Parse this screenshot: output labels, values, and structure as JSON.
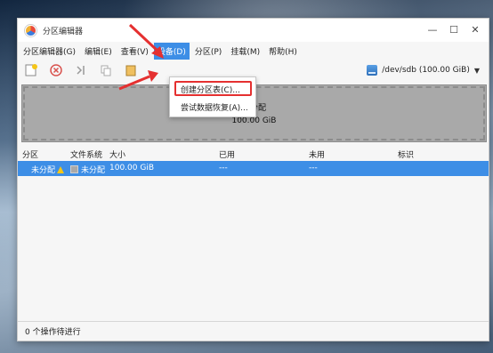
{
  "window": {
    "title": "分区编辑器",
    "controls": [
      "minimize-icon",
      "maximize-icon",
      "close-icon"
    ]
  },
  "menubar": {
    "items": [
      "分区编辑器(G)",
      "编辑(E)",
      "查看(V)",
      "设备(D)",
      "分区(P)",
      "挂载(M)",
      "帮助(H)"
    ],
    "active_index": 3
  },
  "device_menu": {
    "items": [
      "创建分区表(C)...",
      "尝试数据恢复(A)..."
    ],
    "highlighted_index": 0
  },
  "toolbar": {
    "buttons": [
      "new-partition-icon",
      "delete-icon",
      "resize-icon",
      "copy-icon",
      "paste-icon"
    ],
    "device_label": "/dev/sdb (100.00 GiB)"
  },
  "partition_graphic": {
    "name": "未分配",
    "size": "100.00 GiB"
  },
  "table": {
    "columns": [
      "分区",
      "文件系统",
      "大小",
      "已用",
      "未用",
      "标识"
    ],
    "rows": [
      {
        "partition": "未分配",
        "filesystem": "未分配",
        "size": "100.00 GiB",
        "used": "---",
        "unused": "---",
        "flags": ""
      }
    ]
  },
  "status": {
    "text": "0 个操作待进行"
  },
  "colors": {
    "accent": "#3d8ee6",
    "annotation_red": "#e53030",
    "unallocated_gray": "#a9a9a9"
  }
}
